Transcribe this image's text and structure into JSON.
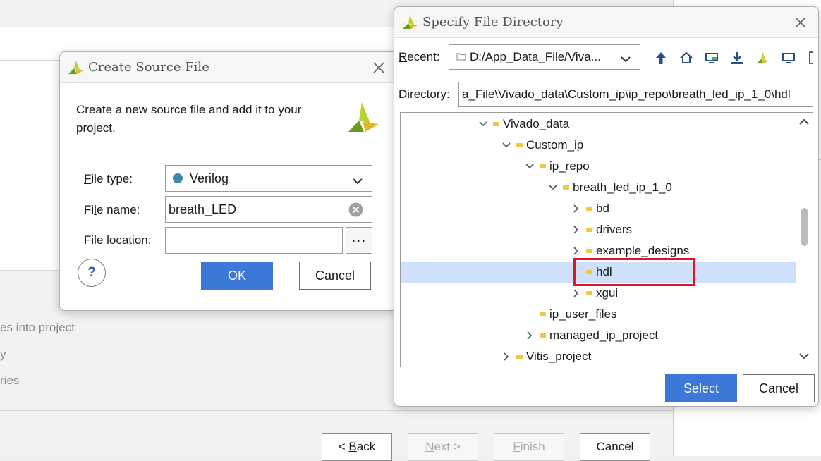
{
  "wizard": {
    "options": [
      "es into project",
      "y",
      "ries"
    ],
    "back_button": "< Back",
    "back_key": "B",
    "back_rest": "ack",
    "next_key": "N",
    "next_rest": "ext >",
    "finish_key": "F",
    "finish_rest": "inish",
    "cancel_button": "Cancel"
  },
  "create_dialog": {
    "title": "Create Source File",
    "message": "Create a new source file and add it to your project.",
    "file_type": {
      "label_key": "F",
      "label_rest": "ile type:",
      "value": "Verilog",
      "dot_color": "#3b89a8"
    },
    "file_name": {
      "label_pre": "Fi",
      "label_key": "l",
      "label_rest": "e name:",
      "value": "breath_LED"
    },
    "file_location": {
      "label_pre": "Fi",
      "label_key": "l",
      "label_rest": "e location:",
      "value": "",
      "browse_glyph": "···"
    },
    "help_glyph": "?",
    "ok_button": "OK",
    "cancel_button": "Cancel"
  },
  "dir_dialog": {
    "title": "Specify File Directory",
    "recent_key": "R",
    "recent_rest": "ecent:",
    "recent_value": "D:/App_Data_File/Viva...",
    "directory_key": "D",
    "directory_rest": "irectory:",
    "directory_value": "a_File\\Vivado_data\\Custom_ip\\ip_repo\\breath_led_ip_1_0\\hdl",
    "toolbar_icons": [
      "up-folder-icon",
      "home-icon",
      "desktop-icon",
      "download-icon",
      "vivado-icon",
      "computer-icon",
      "bracket-icon"
    ],
    "tree": [
      {
        "label": "Vivado_data",
        "state": "expanded"
      },
      {
        "label": "Custom_ip",
        "state": "expanded"
      },
      {
        "label": "ip_repo",
        "state": "expanded"
      },
      {
        "label": "breath_led_ip_1_0",
        "state": "expanded"
      },
      {
        "label": "bd",
        "state": "collapsed"
      },
      {
        "label": "drivers",
        "state": "collapsed"
      },
      {
        "label": "example_designs",
        "state": "collapsed"
      },
      {
        "label": "hdl",
        "state": "leaf",
        "selected": true
      },
      {
        "label": "xgui",
        "state": "collapsed"
      },
      {
        "label": "ip_user_files",
        "state": "leaf"
      },
      {
        "label": "managed_ip_project",
        "state": "collapsed"
      },
      {
        "label": "Vitis_project",
        "state": "collapsed"
      }
    ],
    "select_button": "Select",
    "cancel_button": "Cancel"
  },
  "colors": {
    "accent": "#3c78d8",
    "selection": "#cfe0fb",
    "highlight": "#e0142a",
    "folder": "#f0c840"
  }
}
